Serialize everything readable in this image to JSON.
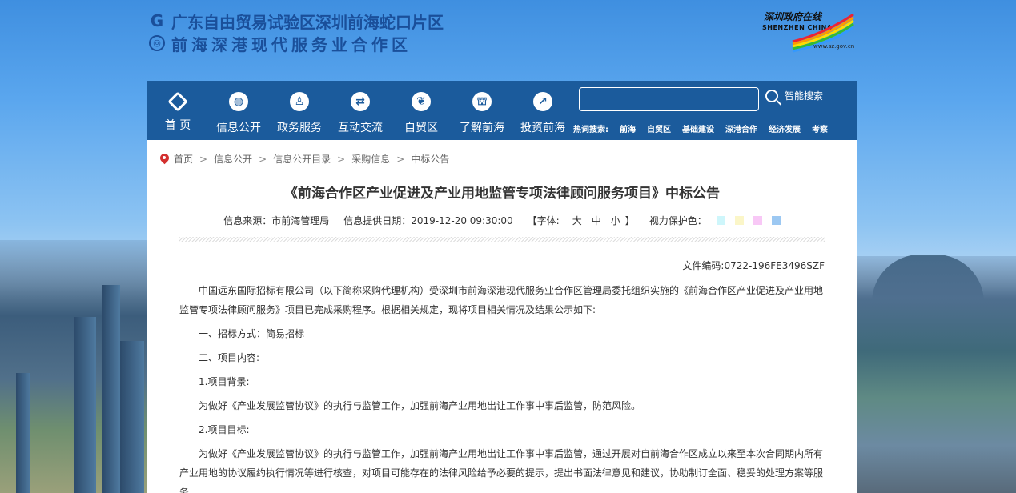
{
  "header": {
    "line1": "广东自由贸易试验区深圳前海蛇口片区",
    "line2": "前海深港现代服务业合作区",
    "logo": {
      "title": "深圳政府在线",
      "subtitle": "SHENZHEN CHINA",
      "url": "www.sz.gov.cn"
    }
  },
  "nav": {
    "items": [
      {
        "label": "首 页",
        "icon": "diamond-icon"
      },
      {
        "label": "信息公开",
        "icon": "globe-icon"
      },
      {
        "label": "政务服务",
        "icon": "stamp-icon"
      },
      {
        "label": "互动交流",
        "icon": "exchange-icon"
      },
      {
        "label": "自贸区",
        "icon": "leaf-icon"
      },
      {
        "label": "了解前海",
        "icon": "emblem-icon"
      },
      {
        "label": "投资前海",
        "icon": "invest-icon"
      }
    ],
    "search": {
      "placeholder": "",
      "button_label": "智能搜索"
    },
    "hot": {
      "label": "热词搜索:",
      "words": [
        "前海",
        "自贸区",
        "基础建设",
        "深港合作",
        "经济发展",
        "考察"
      ]
    }
  },
  "breadcrumb": [
    "首页",
    "信息公开",
    "信息公开目录",
    "采购信息",
    "中标公告"
  ],
  "article": {
    "title": "《前海合作区产业促进及产业用地监管专项法律顾问服务项目》中标公告",
    "source": "信息来源：市前海管理局",
    "date": "信息提供日期：2019-12-20 09:30:00",
    "font_label": "【字体:",
    "font_large": "大",
    "font_medium": "中",
    "font_small": "小",
    "font_end": "】",
    "eye_label": "视力保护色：",
    "eye_colors": [
      "#cef6fb",
      "#fbf6c8",
      "#f8c8f6",
      "#9cc8f2"
    ],
    "doc_no": "文件编码:0722-196FE3496SZF",
    "paragraphs": [
      "中国远东国际招标有限公司（以下简称采购代理机构）受深圳市前海深港现代服务业合作区管理局委托组织实施的《前海合作区产业促进及产业用地监管专项法律顾问服务》项目已完成采购程序。根据相关规定，现将项目相关情况及结果公示如下:",
      "一、招标方式：简易招标",
      "二、项目内容:",
      "1.项目背景:",
      "为做好《产业发展监管协议》的执行与监管工作，加强前海产业用地出让工作事中事后监管，防范风险。",
      "2.项目目标:",
      "为做好《产业发展监管协议》的执行与监管工作，加强前海产业用地出让工作事中事后监管，通过开展对自前海合作区成立以来至本次合同期内所有产业用地的协议履约执行情况等进行核查，对项目可能存在的法律风险给予必要的提示，提出书面法律意见和建议，协助制订全面、稳妥的处理方案等服务。"
    ]
  }
}
